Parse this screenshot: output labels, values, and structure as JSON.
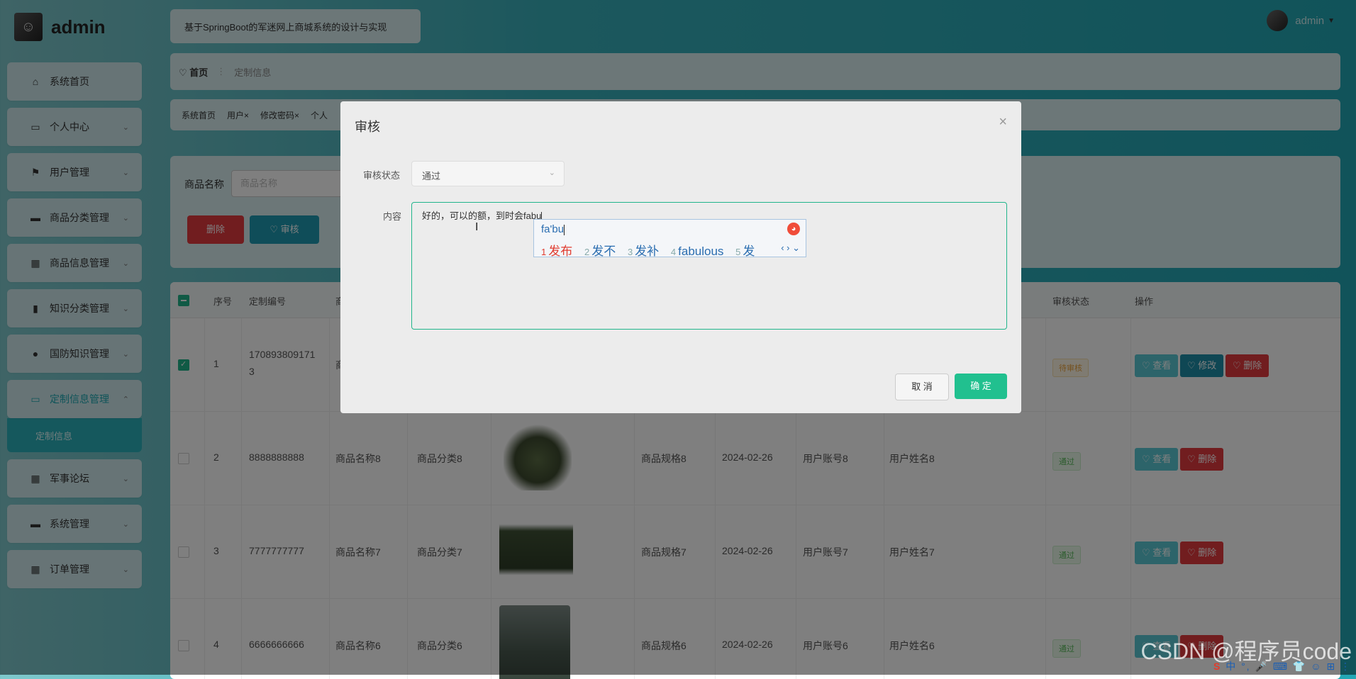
{
  "brand": {
    "name": "admin"
  },
  "header": {
    "title": "基于SpringBoot的军迷网上商城系统的设计与实现",
    "user": "admin"
  },
  "breadcrumb": {
    "home": "首页",
    "current": "定制信息"
  },
  "tabs": [
    "系统首页",
    "用户×",
    "修改密码×",
    "个人"
  ],
  "sidebar": {
    "items": [
      {
        "label": "系统首页",
        "icon": "⌂",
        "chevron": ""
      },
      {
        "label": "个人中心",
        "icon": "▭",
        "chevron": "⌄"
      },
      {
        "label": "用户管理",
        "icon": "⚑",
        "chevron": "⌄"
      },
      {
        "label": "商品分类管理",
        "icon": "▬",
        "chevron": "⌄"
      },
      {
        "label": "商品信息管理",
        "icon": "▦",
        "chevron": "⌄"
      },
      {
        "label": "知识分类管理",
        "icon": "▮",
        "chevron": "⌄"
      },
      {
        "label": "国防知识管理",
        "icon": "●",
        "chevron": "⌄"
      },
      {
        "label": "定制信息管理",
        "icon": "▭",
        "chevron": "⌃"
      },
      {
        "label": "军事论坛",
        "icon": "▦",
        "chevron": "⌄"
      },
      {
        "label": "系统管理",
        "icon": "▬",
        "chevron": "⌄"
      },
      {
        "label": "订单管理",
        "icon": "▦",
        "chevron": "⌄"
      }
    ],
    "submenu_label": "定制信息"
  },
  "search": {
    "label": "商品名称",
    "placeholder": "商品名称",
    "delete_label": "删除",
    "audit_label": "♡ 审核"
  },
  "table": {
    "headers": [
      "序号",
      "定制编号",
      "商",
      "审核状态",
      "操作"
    ],
    "rows": [
      {
        "index": "1",
        "code": "170893809171",
        "code2": "3",
        "name": "商",
        "category": "",
        "spec": "",
        "date": "",
        "account": "",
        "username": "",
        "status": "待审核",
        "image": ""
      },
      {
        "index": "2",
        "code": "8888888888",
        "code2": "",
        "name": "商品名称8",
        "category": "商品分类8",
        "spec": "商品规格8",
        "date": "2024-02-26",
        "account": "用户账号8",
        "username": "用户姓名8",
        "status": "通过",
        "image": "bag"
      },
      {
        "index": "3",
        "code": "7777777777",
        "code2": "",
        "name": "商品名称7",
        "category": "商品分类7",
        "spec": "商品规格7",
        "date": "2024-02-26",
        "account": "用户账号7",
        "username": "用户姓名7",
        "status": "通过",
        "image": "box"
      },
      {
        "index": "4",
        "code": "6666666666",
        "code2": "",
        "name": "商品名称6",
        "category": "商品分类6",
        "spec": "商品规格6",
        "date": "2024-02-26",
        "account": "用户账号6",
        "username": "用户姓名6",
        "status": "通过",
        "image": "man"
      }
    ],
    "ops": {
      "view": "♡ 查看",
      "edit": "♡ 修改",
      "del": "♡ 删除"
    }
  },
  "modal": {
    "title": "审核",
    "close": "×",
    "status_label": "审核状态",
    "status_value": "通过",
    "content_label": "内容",
    "content_value": "好的，可以的额，到时会fabu",
    "cancel": "取 消",
    "ok": "确 定"
  },
  "ime": {
    "composition": "fa'bu",
    "candidates": [
      {
        "n": "1",
        "text": "发布"
      },
      {
        "n": "2",
        "text": "发不"
      },
      {
        "n": "3",
        "text": "发补"
      },
      {
        "n": "4",
        "text": "fabulous"
      },
      {
        "n": "5",
        "text": "发"
      }
    ],
    "nav": "‹ › ⌄"
  },
  "watermark": "CSDN @程序员code",
  "tray": {
    "s": "S",
    "rest": "中 °, 🎤 ⌨ 👕 ☺ ⊞ ⋮"
  }
}
